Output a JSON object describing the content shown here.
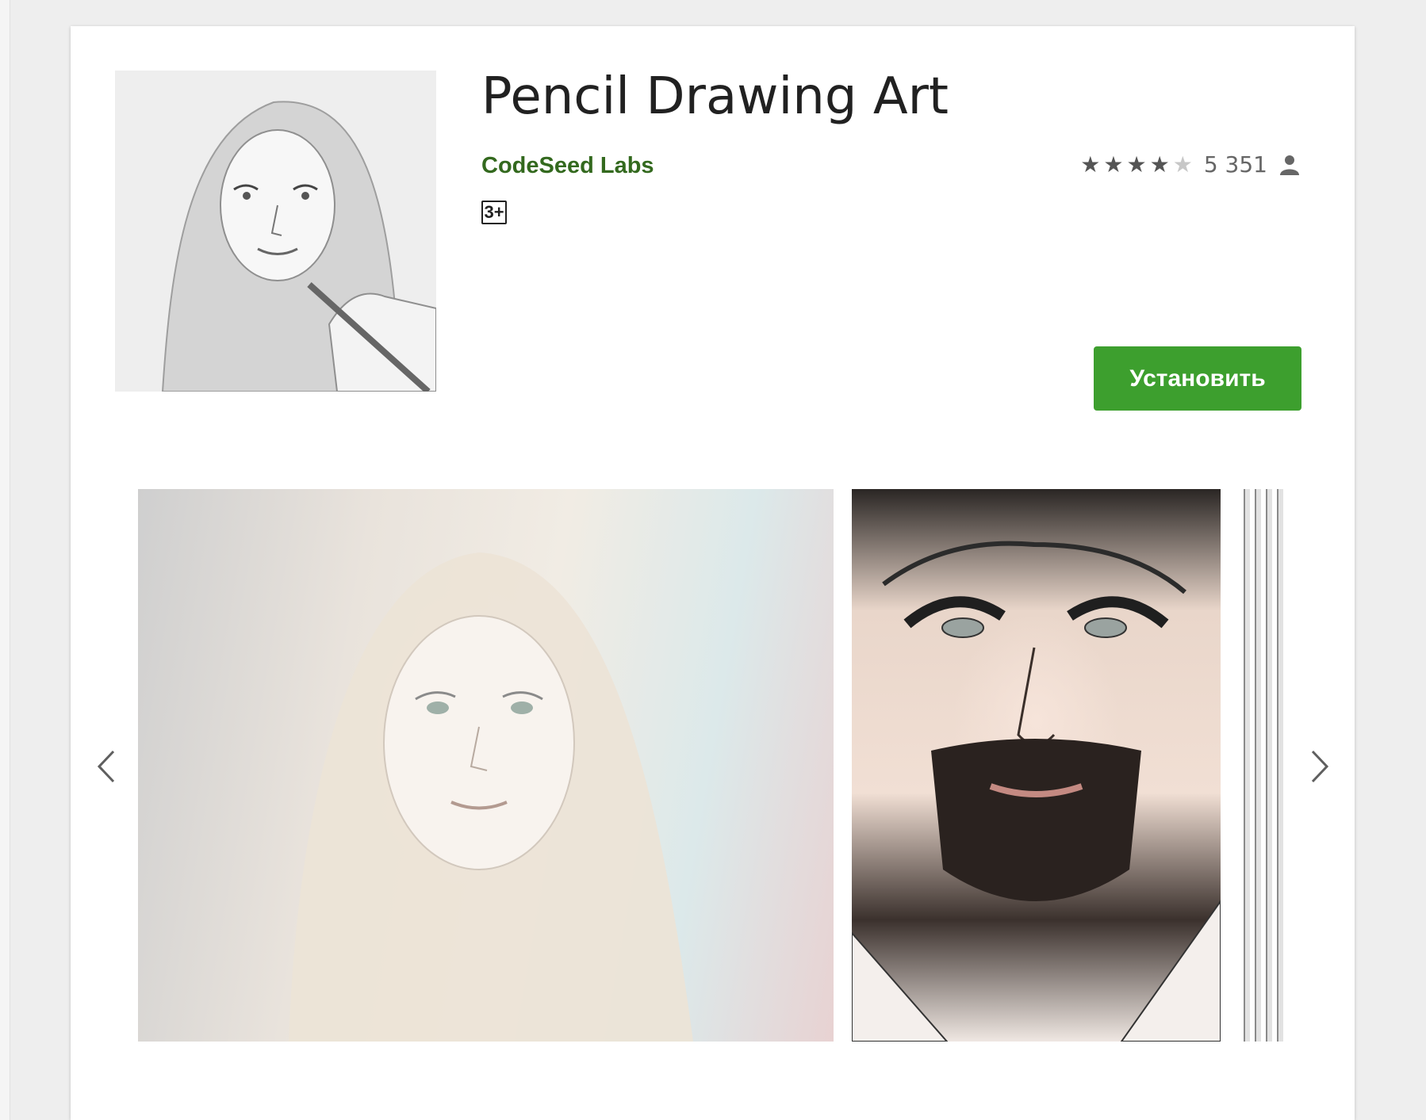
{
  "app": {
    "title": "Pencil Drawing Art",
    "developer": "CodeSeed Labs",
    "age_rating": "3+",
    "rating_stars": 4,
    "rating_max": 5,
    "rating_count": "5 351",
    "install_label": "Установить"
  },
  "colors": {
    "developer_green": "#33691e",
    "install_green": "#3d9f2e"
  },
  "icons": {
    "rating_person": "person-icon",
    "prev": "chevron-left-icon",
    "next": "chevron-right-icon"
  }
}
